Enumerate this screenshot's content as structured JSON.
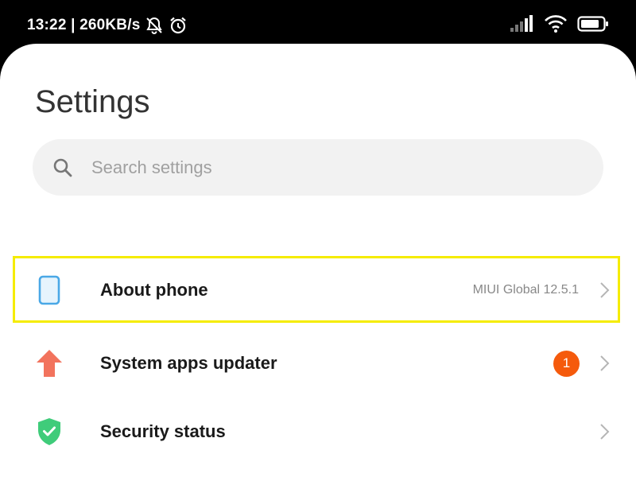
{
  "status_bar": {
    "time_speed": "13:22 | 260KB/s",
    "icons": [
      "bell-muted-icon",
      "alarm-icon",
      "signal-icon",
      "wifi-icon",
      "battery-icon"
    ]
  },
  "page": {
    "title": "Settings"
  },
  "search": {
    "placeholder": "Search settings",
    "icon": "search-icon"
  },
  "items": [
    {
      "label": "About phone",
      "value": "MIUI Global 12.5.1",
      "icon": "phone-icon",
      "icon_color": "#4aa8e6",
      "highlighted": true
    },
    {
      "label": "System apps updater",
      "badge": "1",
      "icon": "up-arrow-icon",
      "icon_color": "#f2735d",
      "badge_color": "#f55a0c"
    },
    {
      "label": "Security status",
      "icon": "shield-check-icon",
      "icon_color": "#3fcc7a"
    }
  ],
  "colors": {
    "highlight": "#f5ec00",
    "background": "#ffffff",
    "status_bar": "#000000"
  }
}
